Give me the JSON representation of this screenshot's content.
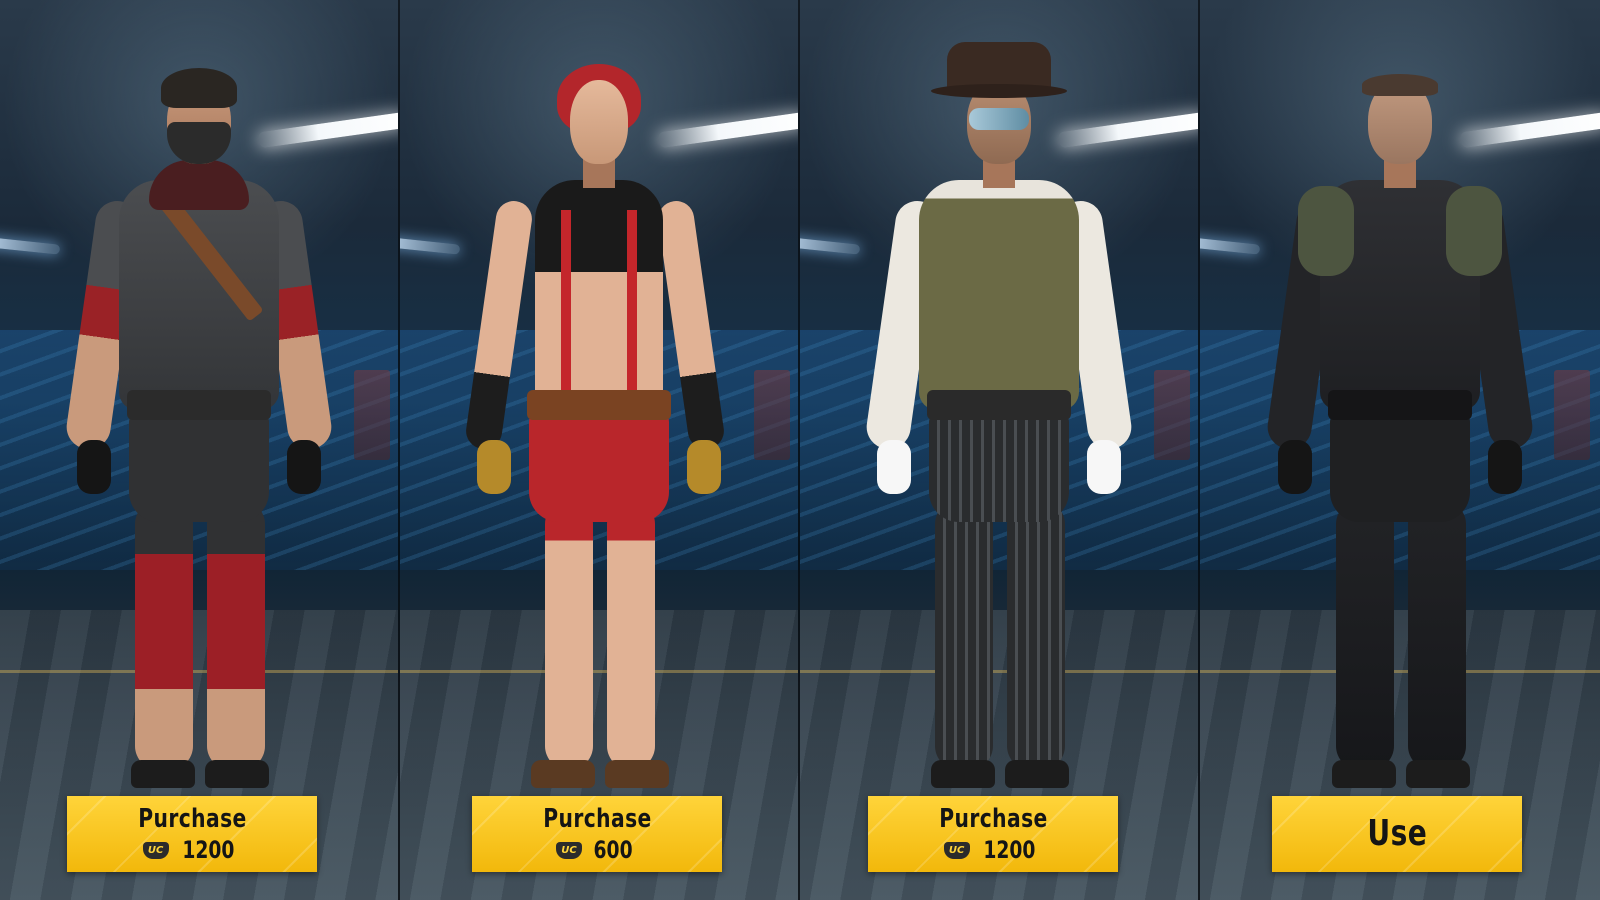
{
  "outfits": [
    {
      "button_label": "Purchase",
      "price": "1200",
      "currency_icon": "uc-currency-icon",
      "currency_text": "UC"
    },
    {
      "button_label": "Purchase",
      "price": "600",
      "currency_icon": "uc-currency-icon",
      "currency_text": "UC"
    },
    {
      "button_label": "Purchase",
      "price": "1200",
      "currency_icon": "uc-currency-icon",
      "currency_text": "UC"
    },
    {
      "button_label": "Use"
    }
  ],
  "colors": {
    "button_yellow": "#ffd43a",
    "button_text": "#151515",
    "background_blue": "#15324a"
  }
}
